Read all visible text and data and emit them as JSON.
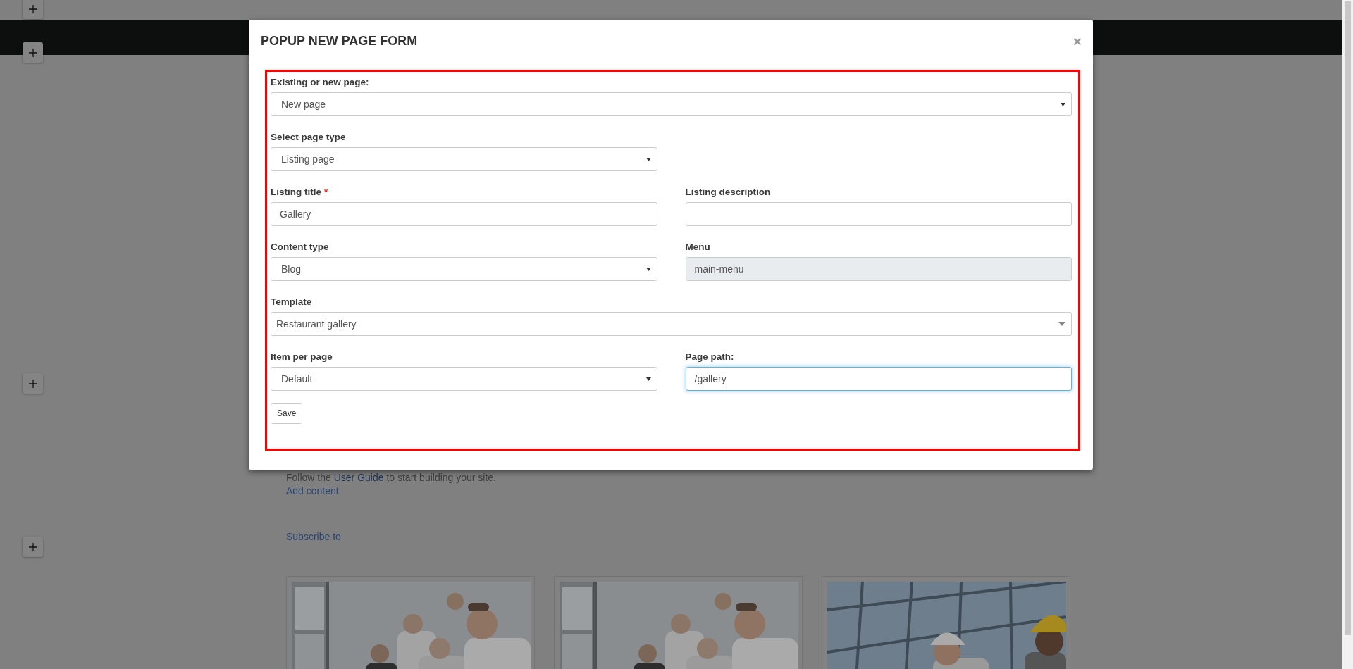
{
  "background": {
    "intro": {
      "before": "Follow the",
      "link": "User Guide",
      "after": "to start building your site."
    },
    "add_content": "Add content",
    "subscribe": "Subscribe to"
  },
  "modal": {
    "title": "POPUP NEW PAGE FORM",
    "close": "×",
    "highlighted": true,
    "rows": [
      {
        "kind": "wide",
        "fields": [
          {
            "kind": "select",
            "label": "Existing or new page:",
            "value": "New page"
          }
        ]
      },
      {
        "kind": "split",
        "fields": [
          {
            "kind": "select",
            "label": "Select page type",
            "value": "Listing page"
          }
        ]
      },
      {
        "kind": "split",
        "fields": [
          {
            "kind": "text",
            "label": "Listing title",
            "required_mark": "*",
            "value": "Gallery",
            "disabled": false,
            "focused": false
          },
          {
            "kind": "text",
            "label": "Listing description",
            "disabled": false,
            "focused": false
          }
        ]
      },
      {
        "kind": "split",
        "fields": [
          {
            "kind": "select",
            "label": "Content type",
            "value": "Blog"
          },
          {
            "kind": "text",
            "label": "Menu",
            "value": "main-menu",
            "disabled": true,
            "focused": false
          }
        ]
      },
      {
        "kind": "wide",
        "fields": [
          {
            "kind": "combo",
            "label": "Template",
            "value": "Restaurant gallery"
          }
        ]
      },
      {
        "kind": "split",
        "fields": [
          {
            "kind": "select",
            "label": "Item per page",
            "value": "Default"
          },
          {
            "kind": "text",
            "label": "Page path:",
            "value": "/gallery",
            "disabled": false,
            "focused": true
          }
        ]
      }
    ],
    "save": "Save"
  }
}
